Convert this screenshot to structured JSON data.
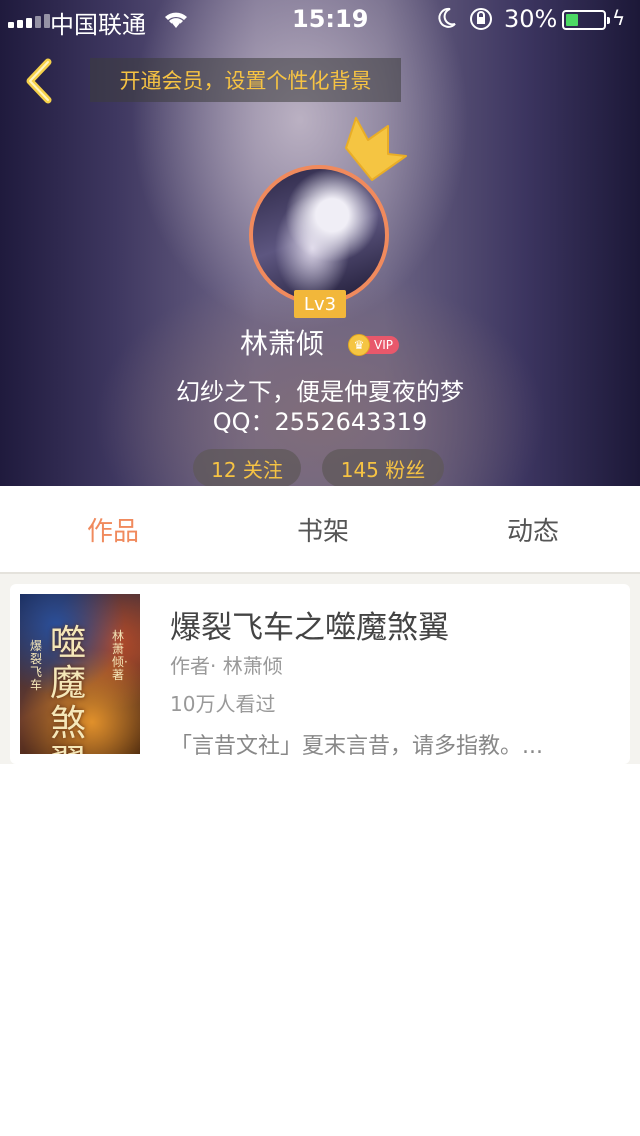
{
  "status_bar": {
    "carrier": "中国联通",
    "time": "15:19",
    "battery": "30%",
    "battery_fill": 0.3,
    "battery_color": "#4cd964"
  },
  "header": {
    "back_icon": "chevron-left-icon",
    "promo": "开通会员，设置个性化背景",
    "level": "Lv3",
    "username": "林萧倾",
    "vip_label": "VIP",
    "signature": "幻纱之下，便是仲夏夜的梦",
    "qq": "QQ：2552643319",
    "following": "12 关注",
    "fans": "145 粉丝",
    "accent_color": "#f6c343"
  },
  "tabs": [
    {
      "label": "作品",
      "active": true
    },
    {
      "label": "书架",
      "active": false
    },
    {
      "label": "动态",
      "active": false
    }
  ],
  "works": [
    {
      "cover_title": "噬魔煞翼",
      "cover_side": "爆裂飞车",
      "cover_author": "林萧倾·著",
      "title": "爆裂飞车之噬魔煞翼",
      "author": "作者· 林萧倾",
      "views": "10万人看过",
      "description": "「言昔文社」夏末言昔，请多指教。..."
    }
  ],
  "colors": {
    "active_tab": "#f08a5d",
    "avatar_ring": "#f08a5d",
    "level_badge": "#f2b73a",
    "vip_tag": "#e8586b"
  }
}
